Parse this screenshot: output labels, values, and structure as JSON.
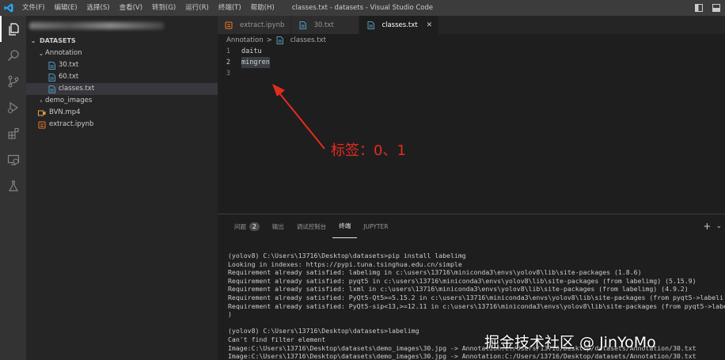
{
  "window": {
    "title": "classes.txt - datasets - Visual Studio Code"
  },
  "menu": [
    "文件(F)",
    "编辑(E)",
    "选择(S)",
    "查看(V)",
    "转到(G)",
    "运行(R)",
    "终端(T)",
    "帮助(H)"
  ],
  "sidebar": {
    "section": "DATASETS",
    "tree": [
      {
        "label": "Annotation",
        "kind": "folder-open",
        "depth": 1
      },
      {
        "label": "30.txt",
        "kind": "txt",
        "depth": 2
      },
      {
        "label": "60.txt",
        "kind": "txt",
        "depth": 2
      },
      {
        "label": "classes.txt",
        "kind": "txt",
        "depth": 2,
        "selected": true
      },
      {
        "label": "demo_images",
        "kind": "folder",
        "depth": 1
      },
      {
        "label": "BVN.mp4",
        "kind": "mp4",
        "depth": 1
      },
      {
        "label": "extract.ipynb",
        "kind": "ipynb",
        "depth": 1
      }
    ]
  },
  "tabs": [
    {
      "label": "extract.ipynb",
      "kind": "ipynb",
      "active": false
    },
    {
      "label": "30.txt",
      "kind": "txt",
      "active": false
    },
    {
      "label": "classes.txt",
      "kind": "txt",
      "active": true,
      "close": "✕"
    }
  ],
  "breadcrumb": {
    "folder": "Annotation",
    "sep": ">",
    "file": "classes.txt"
  },
  "editor": {
    "lines": [
      {
        "num": "1",
        "text": "daitu"
      },
      {
        "num": "2",
        "text": "mingren"
      },
      {
        "num": "3",
        "text": ""
      }
    ]
  },
  "annotation": {
    "text": "标签：0、1",
    "color": "#e52b20"
  },
  "panel": {
    "tabs": [
      {
        "label": "问题",
        "badge": "2"
      },
      {
        "label": "输出"
      },
      {
        "label": "调试控制台"
      },
      {
        "label": "终端",
        "active": true
      },
      {
        "label": "JUPYTER"
      }
    ],
    "actions": {
      "add": "+",
      "dropdown": "⌄"
    }
  },
  "terminal": {
    "lines": [
      "(yolov8) C:\\Users\\13716\\Desktop\\datasets>pip install labelimg",
      "Looking in indexes: https://pypi.tuna.tsinghua.edu.cn/simple",
      "Requirement already satisfied: labelimg in c:\\users\\13716\\miniconda3\\envs\\yolov8\\lib\\site-packages (1.8.6)",
      "Requirement already satisfied: pyqt5 in c:\\users\\13716\\miniconda3\\envs\\yolov8\\lib\\site-packages (from labelimg) (5.15.9)",
      "Requirement already satisfied: lxml in c:\\users\\13716\\miniconda3\\envs\\yolov8\\lib\\site-packages (from labelimg) (4.9.2)",
      "Requirement already satisfied: PyQt5-Qt5>=5.15.2 in c:\\users\\13716\\miniconda3\\envs\\yolov8\\lib\\site-packages (from pyqt5->labeli",
      "Requirement already satisfied: PyQt5-sip<13,>=12.11 in c:\\users\\13716\\miniconda3\\envs\\yolov8\\lib\\site-packages (from pyqt5->label",
      ")",
      "",
      "(yolov8) C:\\Users\\13716\\Desktop\\datasets>labelimg",
      "Can't find filter element",
      "Image:C:\\Users\\13716\\Desktop\\datasets\\demo_images\\30.jpg -> Annotation:C:/Users/13716/Desktop/datasets/Annotation/30.txt",
      "Image:C:\\Users\\13716\\Desktop\\datasets\\demo_images\\30.jpg -> Annotation:C:/Users/13716/Desktop/datasets/Annotation/30.txt"
    ]
  },
  "watermark": "掘金技术社区 @ JinYoMo"
}
